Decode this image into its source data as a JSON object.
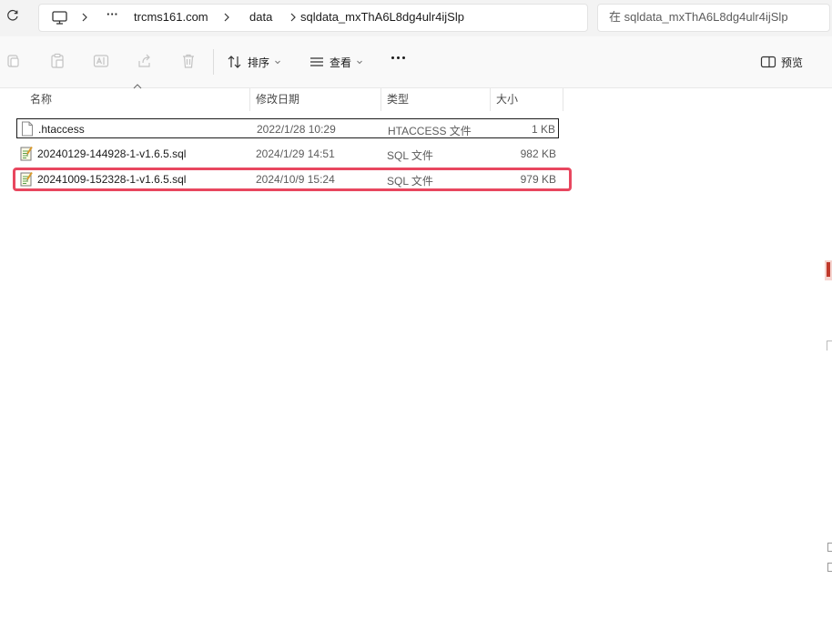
{
  "address_bar": {
    "more": "···",
    "segments": [
      "trcms161.com",
      "data",
      "sqldata_mxThA6L8dg4ulr4ijSlp"
    ]
  },
  "search": {
    "placeholder": "在 sqldata_mxThA6L8dg4ulr4ijSlp"
  },
  "toolbar": {
    "sort_label": "排序",
    "view_label": "查看",
    "preview_label": "预览"
  },
  "columns": {
    "name": "名称",
    "date": "修改日期",
    "type": "类型",
    "size": "大小"
  },
  "files": [
    {
      "name": ".htaccess",
      "date": "2022/1/28 10:29",
      "type": "HTACCESS 文件",
      "size": "1 KB",
      "icon": "blank-file-icon"
    },
    {
      "name": "20240129-144928-1-v1.6.5.sql",
      "date": "2024/1/29 14:51",
      "type": "SQL 文件",
      "size": "982 KB",
      "icon": "sql-file-icon"
    },
    {
      "name": "20241009-152328-1-v1.6.5.sql",
      "date": "2024/10/9 15:24",
      "type": "SQL 文件",
      "size": "979 KB",
      "icon": "sql-file-icon"
    }
  ],
  "colors": {
    "highlight": "#e8475f",
    "toolbar_bg": "#f9f9f9",
    "topbar_bg": "#f3f3f3"
  }
}
